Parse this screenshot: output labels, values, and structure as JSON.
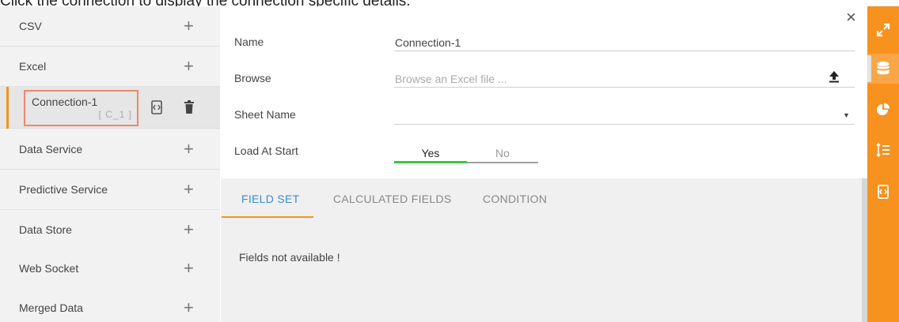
{
  "instruction": "Click the connection to display the connection specific details.",
  "sidebar": {
    "items": [
      {
        "label": "CSV"
      },
      {
        "label": "Excel"
      },
      {
        "label": "Data Service"
      },
      {
        "label": "Predictive Service"
      },
      {
        "label": "Data Store"
      },
      {
        "label": "Web Socket"
      },
      {
        "label": "Merged Data"
      }
    ],
    "plus_glyph": "+",
    "selected_connection": {
      "name": "Connection-1",
      "code": "[ C_1 ]"
    }
  },
  "form": {
    "close_glyph": "×",
    "name": {
      "label": "Name",
      "value": "Connection-1"
    },
    "browse": {
      "label": "Browse",
      "placeholder": "Browse an Excel file ..."
    },
    "sheet": {
      "label": "Sheet Name",
      "value": ""
    },
    "load_at_start": {
      "label": "Load At Start",
      "yes": "Yes",
      "no": "No",
      "selected": "Yes"
    }
  },
  "tabs": {
    "items": [
      {
        "label": "FIELD SET",
        "active": true
      },
      {
        "label": "CALCULATED FIELDS",
        "active": false
      },
      {
        "label": "CONDITION",
        "active": false
      }
    ],
    "empty_message": "Fields not available !"
  },
  "toolbar": {
    "icons": [
      "expand-icon",
      "database-icon",
      "pie-chart-icon",
      "sort-list-icon",
      "script-icon"
    ],
    "active": "database-icon"
  },
  "colors": {
    "accent": "#f7921e",
    "tab_active": "#3b8ad9",
    "toggle_on": "#2ecc40",
    "highlight_box": "#f0866a"
  }
}
